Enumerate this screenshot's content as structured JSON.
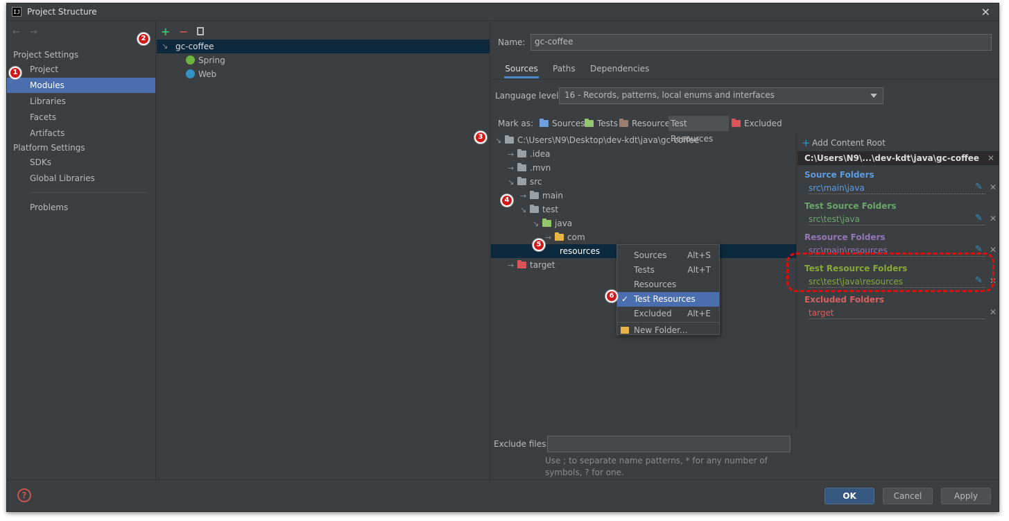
{
  "window": {
    "title": "Project Structure",
    "app_icon": "IJ",
    "close": "✕"
  },
  "nav": {
    "back": "←",
    "forward": "→",
    "project_settings": "Project Settings",
    "project_items": [
      "Project",
      "Modules",
      "Libraries",
      "Facets",
      "Artifacts"
    ],
    "platform_settings": "Platform Settings",
    "platform_items": [
      "SDKs",
      "Global Libraries"
    ],
    "problems": "Problems"
  },
  "modules": {
    "toolbar": {
      "add": "+",
      "remove": "−"
    },
    "root": "gc-coffee",
    "children": [
      "Spring",
      "Web"
    ]
  },
  "details": {
    "name_label": "Name:",
    "name_value": "gc-coffee",
    "tabs": [
      "Sources",
      "Paths",
      "Dependencies"
    ],
    "language_label": "Language level:",
    "language_value": "16 - Records, patterns, local enums and interfaces",
    "mark_as_label": "Mark as:",
    "mark_as": [
      "Sources",
      "Tests",
      "Resources",
      "Test Resources",
      "Excluded"
    ],
    "tree": {
      "root": "C:\\Users\\N9\\Desktop\\dev-kdt\\java\\gc-coffee",
      "idea": ".idea",
      "mvn": ".mvn",
      "src": "src",
      "main": "main",
      "test": "test",
      "java": "java",
      "com": "com",
      "resources": "resources",
      "target": "target"
    },
    "exclude_label": "Exclude files:",
    "exclude_hint": "Use ; to separate name patterns, * for any number of symbols, ? for one."
  },
  "content_root": {
    "add_label": "Add Content Root",
    "path": "C:\\Users\\N9\\...\\dev-kdt\\java\\gc-coffee",
    "source_title": "Source Folders",
    "source_path": "src\\main\\java",
    "test_source_title": "Test Source Folders",
    "test_source_path": "src\\test\\java",
    "resource_title": "Resource Folders",
    "resource_path": "src\\main\\resources",
    "test_resource_title": "Test Resource Folders",
    "test_resource_path": "src\\test\\java\\resources",
    "excluded_title": "Excluded Folders",
    "excluded_path": "target",
    "colors": {
      "source": "#5d9ce0",
      "test": "#6aa66a",
      "resource": "#9576b8",
      "test_resource": "#8aa83a",
      "excluded": "#d75f5f"
    }
  },
  "context_menu": {
    "items": [
      {
        "label": "Sources",
        "shortcut": "Alt+S"
      },
      {
        "label": "Tests",
        "shortcut": "Alt+T"
      },
      {
        "label": "Resources",
        "shortcut": ""
      },
      {
        "label": "Test Resources",
        "shortcut": ""
      },
      {
        "label": "Excluded",
        "shortcut": "Alt+E"
      }
    ],
    "new_folder": "New Folder..."
  },
  "badges": [
    "1",
    "2",
    "3",
    "4",
    "5",
    "6"
  ],
  "footer": {
    "ok": "OK",
    "cancel": "Cancel",
    "apply": "Apply",
    "help": "?"
  }
}
